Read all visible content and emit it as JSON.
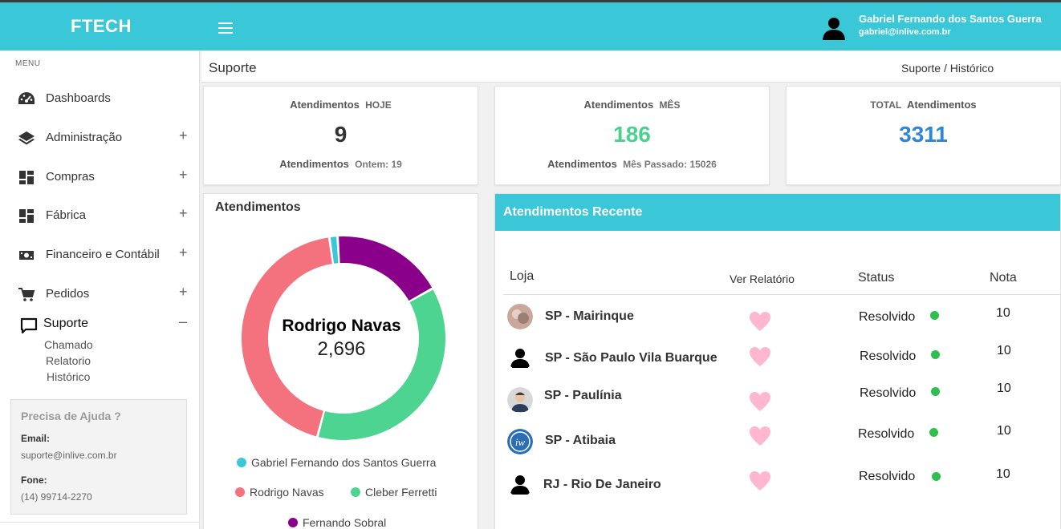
{
  "app": {
    "brand": "FTECH"
  },
  "user": {
    "name": "Gabriel Fernando dos Santos Guerra",
    "email": "gabriel@inlive.com.br"
  },
  "sidebar": {
    "menu_label": "MENU",
    "items": [
      {
        "label": "Dashboards",
        "icon": "dashboard-icon"
      },
      {
        "label": "Administração",
        "icon": "layers-icon",
        "toggle": "+"
      },
      {
        "label": "Compras",
        "icon": "grid-icon",
        "toggle": "+"
      },
      {
        "label": "Fábrica",
        "icon": "grid-icon",
        "toggle": "+"
      },
      {
        "label": "Financeiro e Contábil",
        "icon": "money-icon",
        "toggle": "+"
      },
      {
        "label": "Pedidos",
        "icon": "cart-icon",
        "toggle": "+"
      },
      {
        "label": "Suporte",
        "icon": "chat-icon",
        "toggle": "–"
      }
    ],
    "submenu": [
      "Chamado",
      "Relatorio",
      "Histórico"
    ],
    "help": {
      "title": "Precisa de Ajuda ?",
      "email_label": "Email:",
      "email": "suporte@inlive.com.br",
      "phone_label": "Fone:",
      "phone": "(14) 99714-2270"
    }
  },
  "page": {
    "title": "Suporte",
    "breadcrumb": [
      "Suporte",
      "/ Histórico"
    ]
  },
  "stats": [
    {
      "label": "Atendimentos",
      "label_small": "HOJE",
      "value": "9",
      "sub_label": "Atendimentos",
      "sub_small": "Ontem: 19",
      "color": "#333333"
    },
    {
      "label": "Atendimentos",
      "label_small": "MÊS",
      "value": "186",
      "sub_label": "Atendimentos",
      "sub_small": "Mês Passado: 15026",
      "color": "#4cd08f"
    },
    {
      "label_small": "TOTAL",
      "label": "Atendimentos",
      "value": "3311",
      "color": "#2f86d4"
    }
  ],
  "donut": {
    "title": "Atendimentos",
    "center_name": "Rodrigo Navas",
    "center_value": "2,696"
  },
  "chart_data": {
    "type": "pie",
    "title": "Atendimentos",
    "legend_position": "bottom",
    "series": [
      {
        "name": "Gabriel Fernando dos Santos Guerra",
        "value": 80,
        "color": "#3ac8d8"
      },
      {
        "name": "Rodrigo Navas",
        "value": 2696,
        "color": "#f4717e"
      },
      {
        "name": "Cleber Ferretti",
        "value": 2300,
        "color": "#4cd490"
      },
      {
        "name": "Fernando Sobral",
        "value": 1100,
        "color": "#8b008b"
      }
    ]
  },
  "recent": {
    "title": "Atendimentos Recente",
    "headers": {
      "store": "Loja",
      "report": "Ver Relatório",
      "status": "Status",
      "nota": "Nota"
    },
    "rows": [
      {
        "store": "SP - Mairinque",
        "status": "Resolvido",
        "nota": "10",
        "avatar": "photo-avatar"
      },
      {
        "store": "SP - São Paulo Vila Buarque",
        "status": "Resolvido",
        "nota": "10",
        "avatar": "user-silhouette-avatar"
      },
      {
        "store": "SP - Paulínia",
        "status": "Resolvido",
        "nota": "10",
        "avatar": "man-photo-avatar"
      },
      {
        "store": "SP - Atibaia",
        "status": "Resolvido",
        "nota": "10",
        "avatar": "logo-avatar"
      },
      {
        "store": "RJ - Rio De Janeiro",
        "status": "Resolvido",
        "nota": "10",
        "avatar": "user-silhouette-avatar"
      }
    ],
    "status_color": "#2fbf4f",
    "heart_color": "#ffb6cf"
  }
}
